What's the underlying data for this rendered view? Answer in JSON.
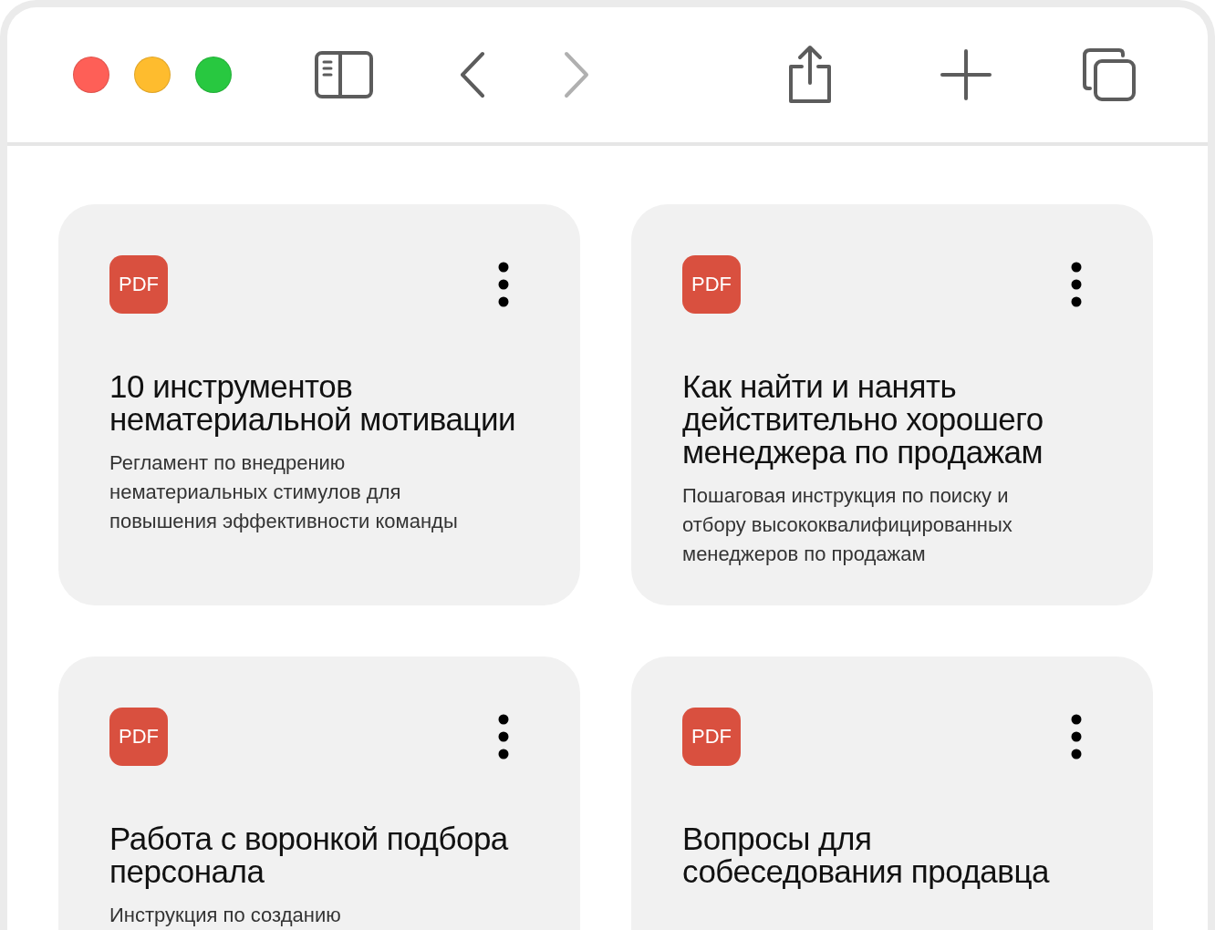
{
  "toolbar": {
    "back": {
      "disabled": false
    },
    "forward": {
      "disabled": true
    }
  },
  "cards": [
    {
      "badge": "PDF",
      "title": "10 инструментов нематериальной мотивации",
      "description": "Регламент по внедрению нематериальных стимулов для повышения эффективности команды"
    },
    {
      "badge": "PDF",
      "title": "Как найти и нанять действительно хорошего менеджера по продажам",
      "description": "Пошаговая инструкция по поиску и отбору высококвалифицированных менеджеров по продажам"
    },
    {
      "badge": "PDF",
      "title": "Работа с воронкой подбора персонала",
      "description": "Инструкция по созданию"
    },
    {
      "badge": "PDF",
      "title": "Вопросы для собеседования продавца"
    }
  ]
}
